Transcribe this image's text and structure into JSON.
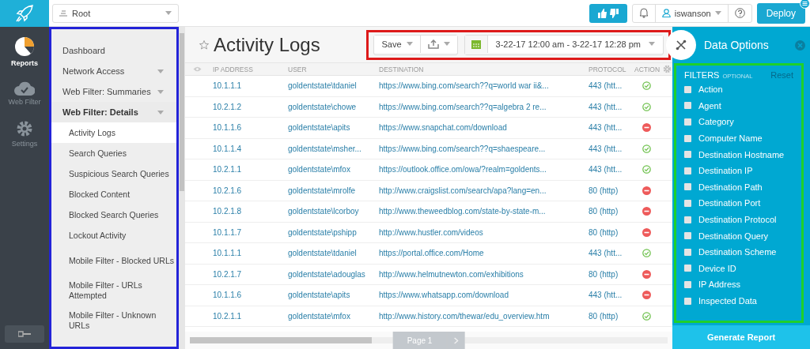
{
  "rail": {
    "items": [
      {
        "label": "Reports",
        "selected": true
      },
      {
        "label": "Web Filter",
        "selected": false
      },
      {
        "label": "Settings",
        "selected": false
      }
    ]
  },
  "topbar": {
    "scope": "Root",
    "user": "iswanson",
    "deploy": "Deploy"
  },
  "sidebar": {
    "items": [
      {
        "label": "Dashboard",
        "kind": "link"
      },
      {
        "label": "Network Access",
        "kind": "group",
        "expanded": false
      },
      {
        "label": "Web Filter: Summaries",
        "kind": "group",
        "expanded": false
      },
      {
        "label": "Web Filter: Details",
        "kind": "group",
        "expanded": true,
        "children": [
          {
            "label": "Activity Logs",
            "selected": true
          },
          {
            "label": "Search Queries",
            "selected": false
          },
          {
            "label": "Suspicious Search Queries",
            "selected": false
          },
          {
            "label": "Blocked Content",
            "selected": false
          },
          {
            "label": "Blocked Search Queries",
            "selected": false
          },
          {
            "label": "Lockout Activity",
            "selected": false
          },
          {
            "label": "Mobile Filter - Blocked URLs",
            "selected": false
          },
          {
            "label": "Mobile Filter - URLs Attempted",
            "selected": false
          },
          {
            "label": "Mobile Filter - Unknown URLs",
            "selected": false
          }
        ]
      }
    ]
  },
  "page": {
    "title": "Activity Logs",
    "favorite": false,
    "save": "Save",
    "date_range": "3-22-17 12:00 am - 3-22-17 12:28 pm"
  },
  "table": {
    "columns": [
      "IP ADDRESS",
      "USER",
      "DESTINATION",
      "PROTOCOL",
      "ACTION"
    ],
    "rows": [
      {
        "ip": "10.1.1.1",
        "user": "goldentstate\\tdaniel",
        "destination": "https://www.bing.com/search??q=world war ii&...",
        "protocol": "443 (htt...",
        "kind": "allowed"
      },
      {
        "ip": "10.2.1.2",
        "user": "goldentstate\\chowe",
        "destination": "https://www.bing.com/search??q=algebra 2 re...",
        "protocol": "443 (htt...",
        "kind": "allowed"
      },
      {
        "ip": "10.1.1.6",
        "user": "goldentstate\\apits",
        "destination": "https://www.snapchat.com/download",
        "protocol": "443 (htt...",
        "kind": "blocked"
      },
      {
        "ip": "10.1.1.4",
        "user": "goldentstate\\msher...",
        "destination": "https://www.bing.com/search??q=shaespeare...",
        "protocol": "443 (htt...",
        "kind": "allowed"
      },
      {
        "ip": "10.2.1.1",
        "user": "goldentstate\\mfox",
        "destination": "https://outlook.office.om/owa/?realm=goldents...",
        "protocol": "443 (htt...",
        "kind": "allowed"
      },
      {
        "ip": "10.2.1.6",
        "user": "goldentstate\\mrolfe",
        "destination": "http://www.craigslist.com/search/apa?lang=en...",
        "protocol": "80 (http)",
        "kind": "blocked"
      },
      {
        "ip": "10.2.1.8",
        "user": "goldentstate\\lcorboy",
        "destination": "http://www.theweedblog.com/state-by-state-m...",
        "protocol": "80 (http)",
        "kind": "blocked"
      },
      {
        "ip": "10.1.1.7",
        "user": "goldentstate\\pshipp",
        "destination": "http://www.hustler.com/videos",
        "protocol": "80 (http)",
        "kind": "blocked"
      },
      {
        "ip": "10.1.1.1",
        "user": "goldentstate\\tdaniel",
        "destination": "https://portal.office.com/Home",
        "protocol": "443 (htt...",
        "kind": "allowed"
      },
      {
        "ip": "10.2.1.7",
        "user": "goldentstate\\adouglas",
        "destination": "http://www.helmutnewton.com/exhibitions",
        "protocol": "80 (http)",
        "kind": "blocked"
      },
      {
        "ip": "10.1.1.6",
        "user": "goldentstate\\apits",
        "destination": "https://www.whatsapp.com/download",
        "protocol": "443 (htt...",
        "kind": "blocked"
      },
      {
        "ip": "10.2.1.1",
        "user": "goldentstate\\mfox",
        "destination": "http://www.history.com/thewar/edu_overview.htm",
        "protocol": "80 (http)",
        "kind": "allowed"
      }
    ]
  },
  "pager": {
    "label": "Page 1"
  },
  "data_options": {
    "title": "Data Options",
    "filters_label": "FILTERS",
    "filters_hint": "OPTIONAL",
    "reset": "Reset",
    "filters": [
      {
        "label": "Action",
        "checked": false
      },
      {
        "label": "Agent",
        "checked": false
      },
      {
        "label": "Category",
        "checked": false
      },
      {
        "label": "Computer Name",
        "checked": false
      },
      {
        "label": "Destination Hostname",
        "checked": false
      },
      {
        "label": "Destination IP",
        "checked": false
      },
      {
        "label": "Destination Path",
        "checked": false
      },
      {
        "label": "Destination Port",
        "checked": false
      },
      {
        "label": "Destination Protocol",
        "checked": false
      },
      {
        "label": "Destination Query",
        "checked": false
      },
      {
        "label": "Destination Scheme",
        "checked": false
      },
      {
        "label": "Device ID",
        "checked": false
      },
      {
        "label": "IP Address",
        "checked": false
      },
      {
        "label": "Inspected Data",
        "checked": false
      }
    ],
    "button": "Generate Report"
  }
}
